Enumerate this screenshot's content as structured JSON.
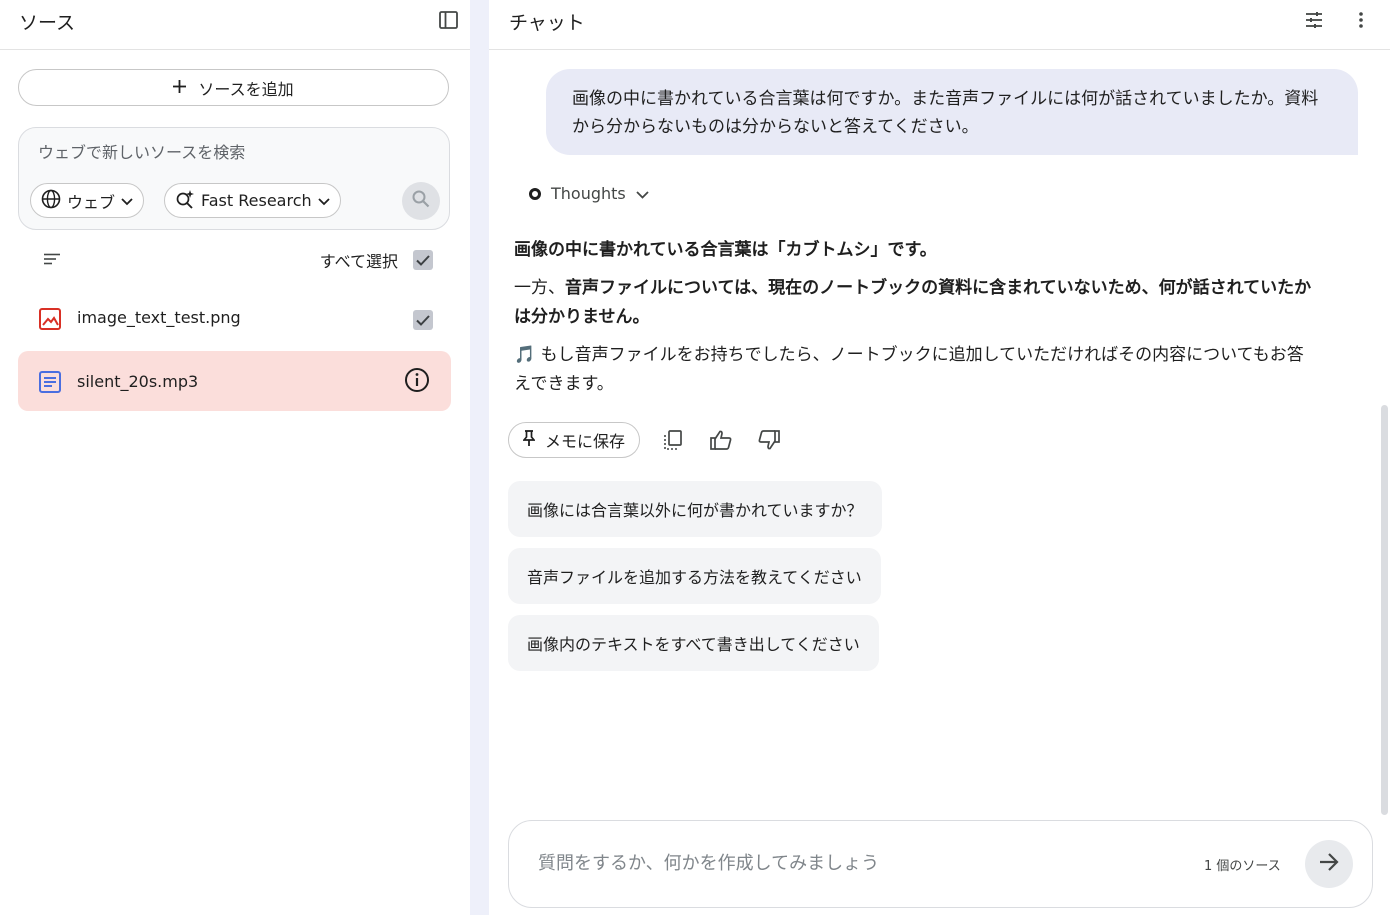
{
  "sources_panel": {
    "title": "ソース",
    "add_source_label": "ソースを追加",
    "search": {
      "placeholder": "ウェブで新しいソースを検索",
      "web_chip_label": "ウェブ",
      "research_chip_label": "Fast Research"
    },
    "select_all_label": "すべて選択",
    "items": [
      {
        "name": "image_text_test.png",
        "type": "image",
        "checked": true
      },
      {
        "name": "silent_20s.mp3",
        "type": "document",
        "status": "info"
      }
    ]
  },
  "chat_panel": {
    "title": "チャット",
    "user_message": "画像の中に書かれている合言葉は何ですか。また音声ファイルには何が話されていましたか。資料から分からないものは分からないと答えてください。",
    "thoughts_label": "Thoughts",
    "answer": {
      "p1_bold": "画像の中に書かれている合言葉は「カブトムシ」です。",
      "p2_prefix": "一方、",
      "p2_bold": "音声ファイルについては、現在のノートブックの資料に含まれていないため、何が話されていたかは分かりません。",
      "p3_emoji": "🎵",
      "p3_text": "もし音声ファイルをお持ちでしたら、ノートブックに追加していただければその内容についてもお答えできます。"
    },
    "save_memo_label": "メモに保存",
    "suggestions": [
      "画像には合言葉以外に何が書かれていますか？",
      "音声ファイルを追加する方法を教えてください",
      "画像内のテキストをすべて書き出してください"
    ],
    "composer": {
      "placeholder": "質問をするか、何かを作成してみましょう",
      "source_count": "1 個のソース"
    }
  },
  "colors": {
    "background": "#eef0fa",
    "active_source": "#fbdedb",
    "user_bubble": "#e8eaf6",
    "image_icon": "#d93025",
    "doc_icon": "#4a6ee0"
  }
}
